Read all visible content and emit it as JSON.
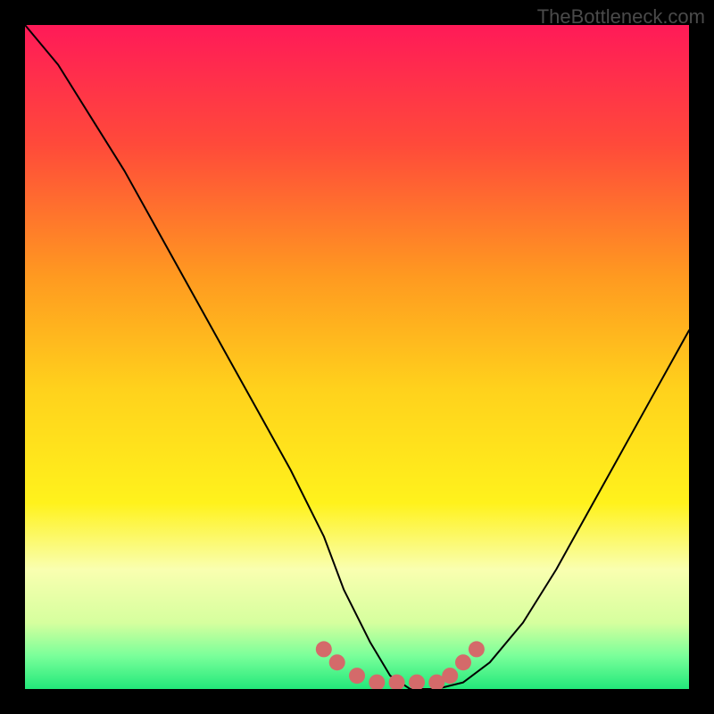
{
  "watermark": "TheBottleneck.com",
  "chart_data": {
    "type": "line",
    "title": "",
    "xlabel": "",
    "ylabel": "",
    "xlim": [
      0,
      100
    ],
    "ylim": [
      0,
      100
    ],
    "grid": false,
    "legend": false,
    "background_gradient": {
      "stops": [
        {
          "offset": 0.0,
          "color": "#ff1a58"
        },
        {
          "offset": 0.18,
          "color": "#ff4a3a"
        },
        {
          "offset": 0.38,
          "color": "#ff9a20"
        },
        {
          "offset": 0.55,
          "color": "#ffd21c"
        },
        {
          "offset": 0.72,
          "color": "#fff21c"
        },
        {
          "offset": 0.82,
          "color": "#f9ffb0"
        },
        {
          "offset": 0.9,
          "color": "#d6ff9e"
        },
        {
          "offset": 0.95,
          "color": "#7aff9a"
        },
        {
          "offset": 1.0,
          "color": "#22e87a"
        }
      ]
    },
    "series": [
      {
        "name": "bottleneck-curve",
        "color": "#000000",
        "stroke_width": 2,
        "x": [
          0,
          5,
          10,
          15,
          20,
          25,
          30,
          35,
          40,
          45,
          48,
          52,
          55,
          58,
          62,
          66,
          70,
          75,
          80,
          85,
          90,
          95,
          100
        ],
        "y": [
          100,
          94,
          86,
          78,
          69,
          60,
          51,
          42,
          33,
          23,
          15,
          7,
          2,
          0,
          0,
          1,
          4,
          10,
          18,
          27,
          36,
          45,
          54
        ]
      }
    ],
    "markers": {
      "name": "optimal-range",
      "color": "#d46a6a",
      "points": [
        {
          "x": 45,
          "y": 6
        },
        {
          "x": 47,
          "y": 4
        },
        {
          "x": 50,
          "y": 2
        },
        {
          "x": 53,
          "y": 1
        },
        {
          "x": 56,
          "y": 1
        },
        {
          "x": 59,
          "y": 1
        },
        {
          "x": 62,
          "y": 1
        },
        {
          "x": 64,
          "y": 2
        },
        {
          "x": 66,
          "y": 4
        },
        {
          "x": 68,
          "y": 6
        }
      ],
      "radius": 9
    }
  }
}
